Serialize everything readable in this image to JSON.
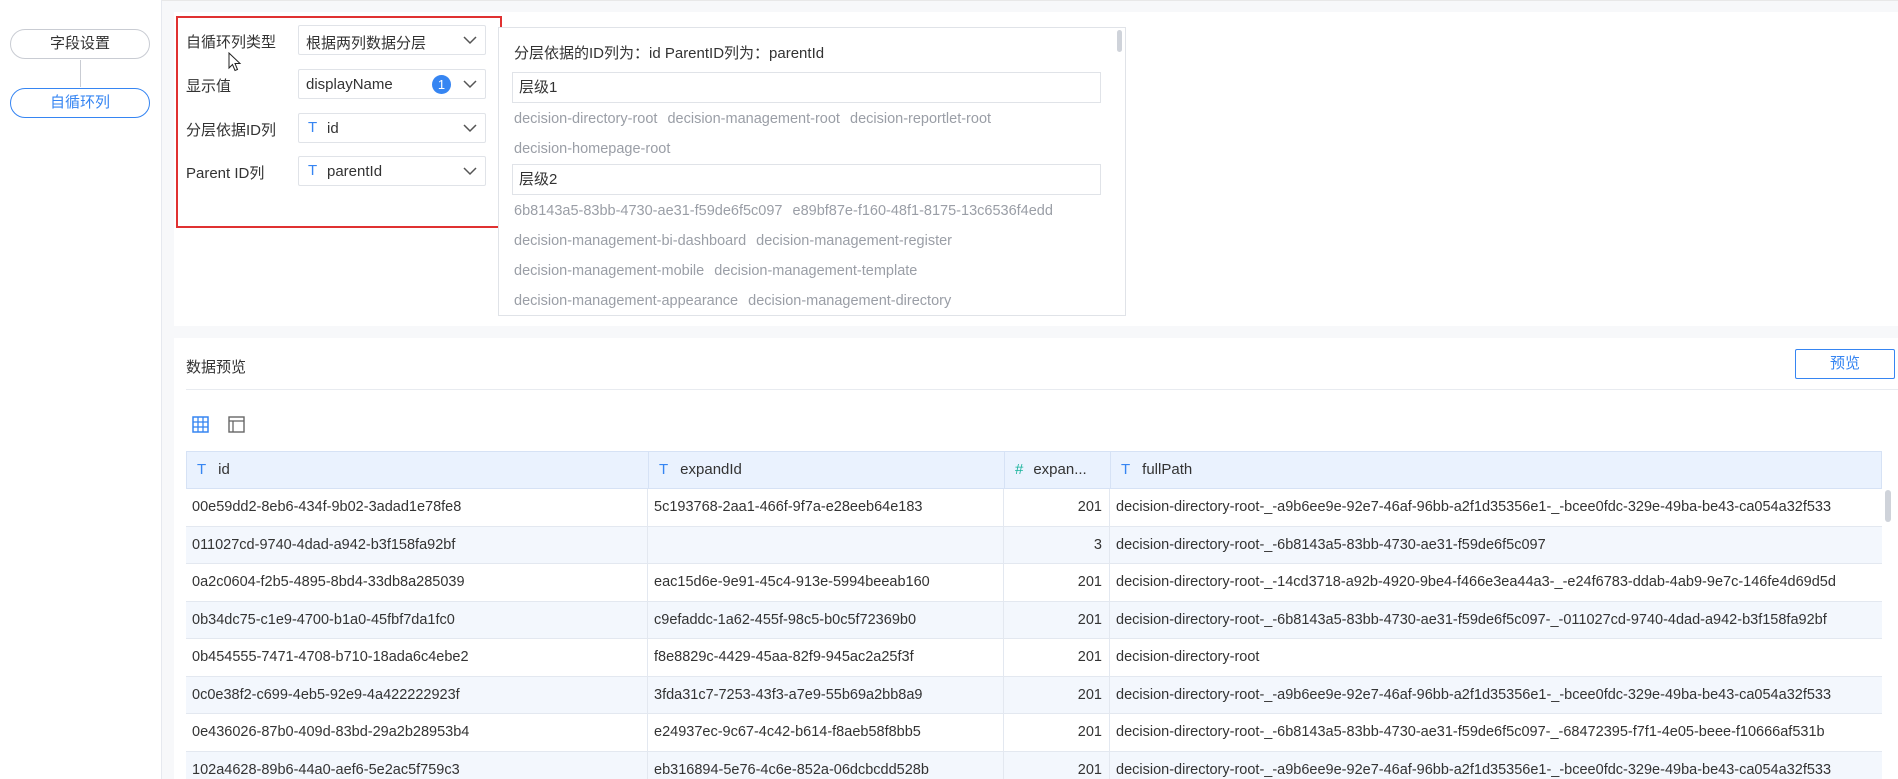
{
  "steps": [
    {
      "label": "字段设置",
      "active": false
    },
    {
      "label": "自循环列",
      "active": true
    }
  ],
  "config": {
    "loop_type": {
      "label": "自循环列类型",
      "value": "根据两列数据分层"
    },
    "display": {
      "label": "显示值",
      "value": "displayName",
      "badge": "1"
    },
    "layer_id": {
      "label": "分层依据ID列",
      "type_icon": "T",
      "value": "id"
    },
    "parent_id": {
      "label": "Parent ID列",
      "type_icon": "T",
      "value": "parentId"
    }
  },
  "levels": {
    "description": "分层依据的ID列为：id  ParentID列为：parentId",
    "groups": [
      {
        "name": "层级1",
        "lines": [
          [
            "decision-directory-root",
            "decision-management-root",
            "decision-reportlet-root"
          ],
          [
            "decision-homepage-root"
          ]
        ]
      },
      {
        "name": "层级2",
        "lines": [
          [
            "6b8143a5-83bb-4730-ae31-f59de6f5c097",
            "e89bf87e-f160-48f1-8175-13c6536f4edd"
          ],
          [
            "decision-management-bi-dashboard",
            "decision-management-register"
          ],
          [
            "decision-management-mobile",
            "decision-management-template"
          ],
          [
            "decision-management-appearance",
            "decision-management-directory"
          ]
        ]
      }
    ]
  },
  "preview": {
    "title": "数据预览",
    "button_label": "预览",
    "view_icons": [
      "grid-view-icon",
      "layout-view-icon"
    ],
    "table": {
      "columns": [
        {
          "name": "id",
          "type": "T"
        },
        {
          "name": "expandId",
          "type": "T"
        },
        {
          "name": "expan...",
          "type": "#"
        },
        {
          "name": "fullPath",
          "type": "T"
        }
      ],
      "rows": [
        [
          "00e59dd2-8eb6-434f-9b02-3adad1e78fe8",
          "5c193768-2aa1-466f-9f7a-e28eeb64e183",
          "201",
          "decision-directory-root-_-a9b6ee9e-92e7-46af-96bb-a2f1d35356e1-_-bcee0fdc-329e-49ba-be43-ca054a32f533"
        ],
        [
          "011027cd-9740-4dad-a942-b3f158fa92bf",
          "",
          "3",
          "decision-directory-root-_-6b8143a5-83bb-4730-ae31-f59de6f5c097"
        ],
        [
          "0a2c0604-f2b5-4895-8bd4-33db8a285039",
          "eac15d6e-9e91-45c4-913e-5994beeab160",
          "201",
          "decision-directory-root-_-14cd3718-a92b-4920-9be4-f466e3ea44a3-_-e24f6783-ddab-4ab9-9e7c-146fe4d69d5d"
        ],
        [
          "0b34dc75-c1e9-4700-b1a0-45fbf7da1fc0",
          "c9efaddc-1a62-455f-98c5-b0c5f72369b0",
          "201",
          "decision-directory-root-_-6b8143a5-83bb-4730-ae31-f59de6f5c097-_-011027cd-9740-4dad-a942-b3f158fa92bf"
        ],
        [
          "0b454555-7471-4708-b710-18ada6c4ebe2",
          "f8e8829c-4429-45aa-82f9-945ac2a25f3f",
          "201",
          "decision-directory-root"
        ],
        [
          "0c0e38f2-c699-4eb5-92e9-4a422222923f",
          "3fda31c7-7253-43f3-a7e9-55b69a2bb8a9",
          "201",
          "decision-directory-root-_-a9b6ee9e-92e7-46af-96bb-a2f1d35356e1-_-bcee0fdc-329e-49ba-be43-ca054a32f533"
        ],
        [
          "0e436026-87b0-409d-83bd-29a2b28953b4",
          "e24937ec-9c67-4c42-b614-f8aeb58f8bb5",
          "201",
          "decision-directory-root-_-6b8143a5-83bb-4730-ae31-f59de6f5c097-_-68472395-f7f1-4e05-beee-f10666af531b"
        ],
        [
          "102a4628-89b6-44a0-aef6-5e2ac5f759c3",
          "eb316894-5e76-4c6e-852a-06dcbcdd528b",
          "201",
          "decision-directory-root-_-a9b6ee9e-92e7-46af-96bb-a2f1d35356e1-_-bcee0fdc-329e-49ba-be43-ca054a32f533"
        ]
      ]
    }
  },
  "colors": {
    "accent": "#3685f2",
    "highlight_border": "#e03131",
    "number_type": "#19b39b"
  }
}
